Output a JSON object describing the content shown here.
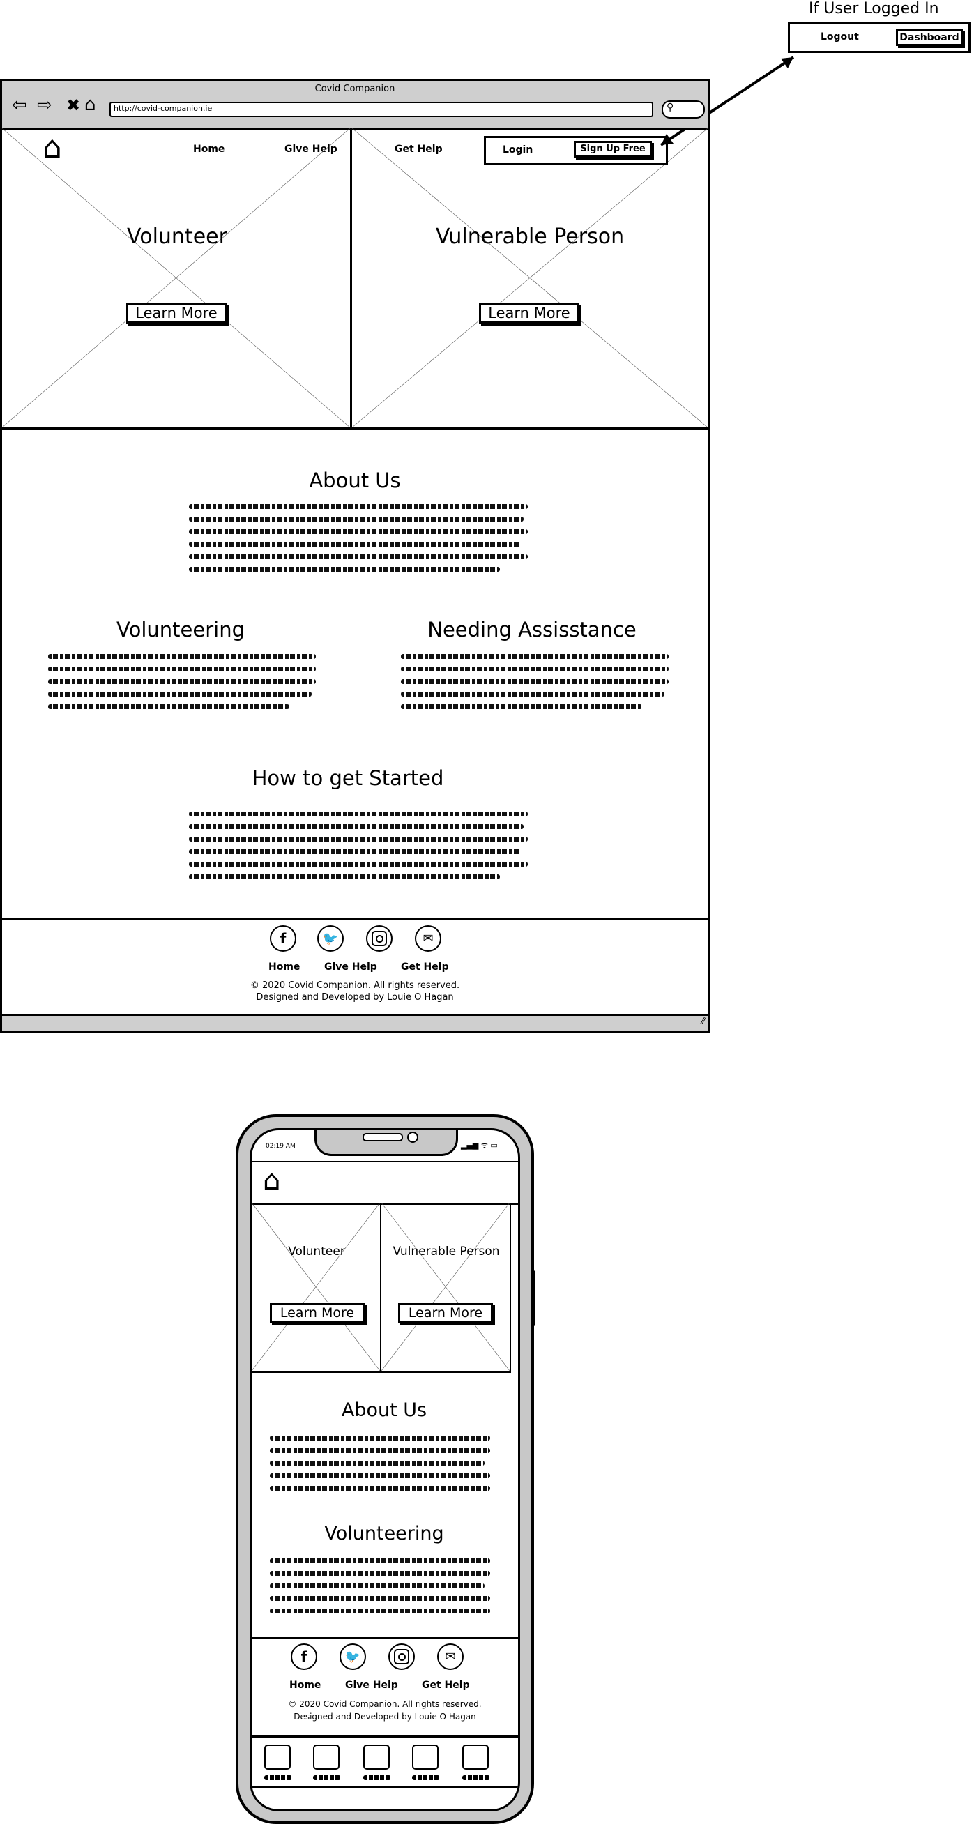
{
  "annotation": {
    "title": "If User Logged In",
    "logout": "Logout",
    "dashboard": "Dashboard"
  },
  "browser": {
    "title": "Covid Companion",
    "url": "http://covid-companion.ie"
  },
  "nav": {
    "home": "Home",
    "give_help": "Give Help",
    "get_help": "Get Help",
    "login": "Login",
    "signup": "Sign Up Free"
  },
  "hero": {
    "volunteer": {
      "title": "Volunteer",
      "button": "Learn More"
    },
    "vulnerable": {
      "title": "Vulnerable Person",
      "button": "Learn More"
    }
  },
  "sections": {
    "about": "About Us",
    "volunteering": "Volunteering",
    "needing": "Needing Assisstance",
    "started": "How to get Started"
  },
  "footer": {
    "links": [
      "Home",
      "Give Help",
      "Get Help"
    ],
    "copyright": "© 2020 Covid Companion. All rights reserved.",
    "credit": "Designed and Developed by Louie O Hagan",
    "icons": [
      "facebook-icon",
      "twitter-icon",
      "instagram-icon",
      "mail-icon"
    ]
  },
  "mobile": {
    "time": "02:19 AM",
    "hero": {
      "volunteer": {
        "title": "Volunteer",
        "button": "Learn More"
      },
      "vulnerable": {
        "title": "Vulnerable Person",
        "button": "Learn More"
      }
    },
    "about": "About Us",
    "volunteering": "Volunteering",
    "footer": {
      "links": [
        "Home",
        "Give Help",
        "Get Help"
      ],
      "copyright": "© 2020 Covid Companion. All rights reserved.",
      "credit": "Designed and Developed by Louie O Hagan"
    },
    "tabbar_count": 5
  }
}
